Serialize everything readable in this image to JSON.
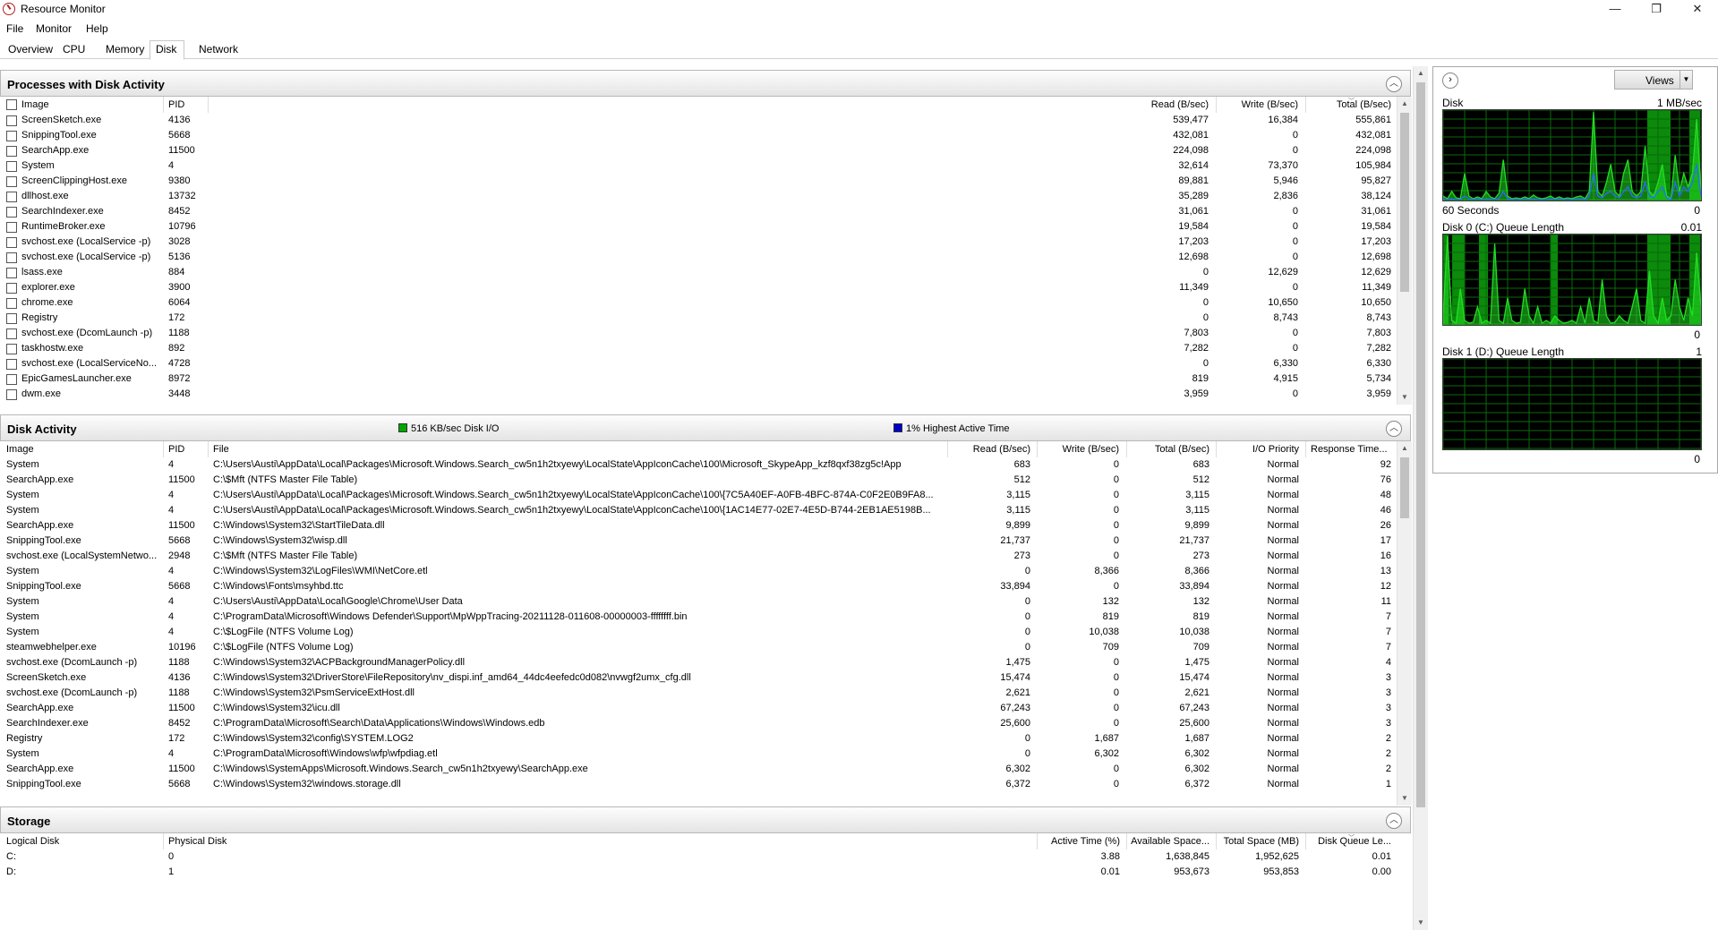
{
  "window": {
    "title": "Resource Monitor",
    "minimize": "—",
    "maximize": "❐",
    "close": "✕"
  },
  "menu": [
    "File",
    "Monitor",
    "Help"
  ],
  "tabs": [
    "Overview",
    "CPU",
    "Memory",
    "Disk",
    "Network"
  ],
  "active_tab": "Disk",
  "processes": {
    "title": "Processes with Disk Activity",
    "columns": [
      "Image",
      "PID",
      "Read (B/sec)",
      "Write (B/sec)",
      "Total (B/sec)"
    ],
    "rows": [
      [
        "ScreenSketch.exe",
        "4136",
        "539,477",
        "16,384",
        "555,861"
      ],
      [
        "SnippingTool.exe",
        "5668",
        "432,081",
        "0",
        "432,081"
      ],
      [
        "SearchApp.exe",
        "11500",
        "224,098",
        "0",
        "224,098"
      ],
      [
        "System",
        "4",
        "32,614",
        "73,370",
        "105,984"
      ],
      [
        "ScreenClippingHost.exe",
        "9380",
        "89,881",
        "5,946",
        "95,827"
      ],
      [
        "dllhost.exe",
        "13732",
        "35,289",
        "2,836",
        "38,124"
      ],
      [
        "SearchIndexer.exe",
        "8452",
        "31,061",
        "0",
        "31,061"
      ],
      [
        "RuntimeBroker.exe",
        "10796",
        "19,584",
        "0",
        "19,584"
      ],
      [
        "svchost.exe (LocalService -p)",
        "3028",
        "17,203",
        "0",
        "17,203"
      ],
      [
        "svchost.exe (LocalService -p)",
        "5136",
        "12,698",
        "0",
        "12,698"
      ],
      [
        "lsass.exe",
        "884",
        "0",
        "12,629",
        "12,629"
      ],
      [
        "explorer.exe",
        "3900",
        "11,349",
        "0",
        "11,349"
      ],
      [
        "chrome.exe",
        "6064",
        "0",
        "10,650",
        "10,650"
      ],
      [
        "Registry",
        "172",
        "0",
        "8,743",
        "8,743"
      ],
      [
        "svchost.exe (DcomLaunch -p)",
        "1188",
        "7,803",
        "0",
        "7,803"
      ],
      [
        "taskhostw.exe",
        "892",
        "7,282",
        "0",
        "7,282"
      ],
      [
        "svchost.exe (LocalServiceNo...",
        "4728",
        "0",
        "6,330",
        "6,330"
      ],
      [
        "EpicGamesLauncher.exe",
        "8972",
        "819",
        "4,915",
        "5,734"
      ],
      [
        "dwm.exe",
        "3448",
        "3,959",
        "0",
        "3,959"
      ]
    ]
  },
  "disk_activity": {
    "title": "Disk Activity",
    "legend_io": "516 KB/sec Disk I/O",
    "legend_active": "1% Highest Active Time",
    "legend_io_color": "#00a800",
    "legend_active_color": "#0000c8",
    "columns": [
      "Image",
      "PID",
      "File",
      "Read (B/sec)",
      "Write (B/sec)",
      "Total (B/sec)",
      "I/O Priority",
      "Response Time..."
    ],
    "rows": [
      [
        "System",
        "4",
        "C:\\Users\\Austi\\AppData\\Local\\Packages\\Microsoft.Windows.Search_cw5n1h2txyewy\\LocalState\\AppIconCache\\100\\Microsoft_SkypeApp_kzf8qxf38zg5c!App",
        "683",
        "0",
        "683",
        "Normal",
        "92"
      ],
      [
        "SearchApp.exe",
        "11500",
        "C:\\$Mft (NTFS Master File Table)",
        "512",
        "0",
        "512",
        "Normal",
        "76"
      ],
      [
        "System",
        "4",
        "C:\\Users\\Austi\\AppData\\Local\\Packages\\Microsoft.Windows.Search_cw5n1h2txyewy\\LocalState\\AppIconCache\\100\\{7C5A40EF-A0FB-4BFC-874A-C0F2E0B9FA8...",
        "3,115",
        "0",
        "3,115",
        "Normal",
        "48"
      ],
      [
        "System",
        "4",
        "C:\\Users\\Austi\\AppData\\Local\\Packages\\Microsoft.Windows.Search_cw5n1h2txyewy\\LocalState\\AppIconCache\\100\\{1AC14E77-02E7-4E5D-B744-2EB1AE5198B...",
        "3,115",
        "0",
        "3,115",
        "Normal",
        "46"
      ],
      [
        "SearchApp.exe",
        "11500",
        "C:\\Windows\\System32\\StartTileData.dll",
        "9,899",
        "0",
        "9,899",
        "Normal",
        "26"
      ],
      [
        "SnippingTool.exe",
        "5668",
        "C:\\Windows\\System32\\wisp.dll",
        "21,737",
        "0",
        "21,737",
        "Normal",
        "17"
      ],
      [
        "svchost.exe (LocalSystemNetwo...",
        "2948",
        "C:\\$Mft (NTFS Master File Table)",
        "273",
        "0",
        "273",
        "Normal",
        "16"
      ],
      [
        "System",
        "4",
        "C:\\Windows\\System32\\LogFiles\\WMI\\NetCore.etl",
        "0",
        "8,366",
        "8,366",
        "Normal",
        "13"
      ],
      [
        "SnippingTool.exe",
        "5668",
        "C:\\Windows\\Fonts\\msyhbd.ttc",
        "33,894",
        "0",
        "33,894",
        "Normal",
        "12"
      ],
      [
        "System",
        "4",
        "C:\\Users\\Austi\\AppData\\Local\\Google\\Chrome\\User Data",
        "0",
        "132",
        "132",
        "Normal",
        "11"
      ],
      [
        "System",
        "4",
        "C:\\ProgramData\\Microsoft\\Windows Defender\\Support\\MpWppTracing-20211128-011608-00000003-ffffffff.bin",
        "0",
        "819",
        "819",
        "Normal",
        "7"
      ],
      [
        "System",
        "4",
        "C:\\$LogFile (NTFS Volume Log)",
        "0",
        "10,038",
        "10,038",
        "Normal",
        "7"
      ],
      [
        "steamwebhelper.exe",
        "10196",
        "C:\\$LogFile (NTFS Volume Log)",
        "0",
        "709",
        "709",
        "Normal",
        "7"
      ],
      [
        "svchost.exe (DcomLaunch -p)",
        "1188",
        "C:\\Windows\\System32\\ACPBackgroundManagerPolicy.dll",
        "1,475",
        "0",
        "1,475",
        "Normal",
        "4"
      ],
      [
        "ScreenSketch.exe",
        "4136",
        "C:\\Windows\\System32\\DriverStore\\FileRepository\\nv_dispi.inf_amd64_44dc4eefedc0d082\\nvwgf2umx_cfg.dll",
        "15,474",
        "0",
        "15,474",
        "Normal",
        "3"
      ],
      [
        "svchost.exe (DcomLaunch -p)",
        "1188",
        "C:\\Windows\\System32\\PsmServiceExtHost.dll",
        "2,621",
        "0",
        "2,621",
        "Normal",
        "3"
      ],
      [
        "SearchApp.exe",
        "11500",
        "C:\\Windows\\System32\\icu.dll",
        "67,243",
        "0",
        "67,243",
        "Normal",
        "3"
      ],
      [
        "SearchIndexer.exe",
        "8452",
        "C:\\ProgramData\\Microsoft\\Search\\Data\\Applications\\Windows\\Windows.edb",
        "25,600",
        "0",
        "25,600",
        "Normal",
        "3"
      ],
      [
        "Registry",
        "172",
        "C:\\Windows\\System32\\config\\SYSTEM.LOG2",
        "0",
        "1,687",
        "1,687",
        "Normal",
        "2"
      ],
      [
        "System",
        "4",
        "C:\\ProgramData\\Microsoft\\Windows\\wfp\\wfpdiag.etl",
        "0",
        "6,302",
        "6,302",
        "Normal",
        "2"
      ],
      [
        "SearchApp.exe",
        "11500",
        "C:\\Windows\\SystemApps\\Microsoft.Windows.Search_cw5n1h2txyewy\\SearchApp.exe",
        "6,302",
        "0",
        "6,302",
        "Normal",
        "2"
      ],
      [
        "SnippingTool.exe",
        "5668",
        "C:\\Windows\\System32\\windows.storage.dll",
        "6,372",
        "0",
        "6,372",
        "Normal",
        "1"
      ]
    ]
  },
  "storage": {
    "title": "Storage",
    "columns": [
      "Logical Disk",
      "Physical Disk",
      "Active Time (%)",
      "Available Space...",
      "Total Space (MB)",
      "Disk Queue Le..."
    ],
    "rows": [
      [
        "C:",
        "0",
        "3.88",
        "1,638,845",
        "1,952,625",
        "0.01"
      ],
      [
        "D:",
        "1",
        "0.01",
        "953,673",
        "953,853",
        "0.00"
      ]
    ]
  },
  "right_pane": {
    "views_label": "Views",
    "graphs": [
      {
        "title": "Disk",
        "scale": "1 MB/sec",
        "foot_left": "60 Seconds",
        "foot_right": "0"
      },
      {
        "title": "Disk 0 (C:) Queue Length",
        "scale": "0.01",
        "foot_left": "",
        "foot_right": "0"
      },
      {
        "title": "Disk 1 (D:) Queue Length",
        "scale": "1",
        "foot_left": "",
        "foot_right": "0"
      }
    ]
  }
}
